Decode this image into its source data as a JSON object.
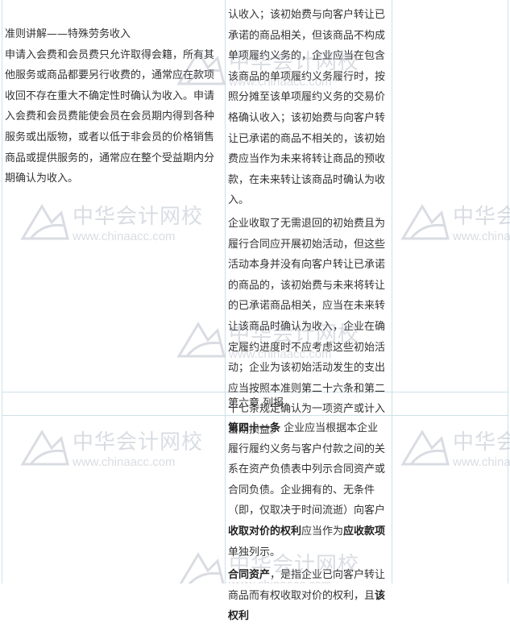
{
  "left_cell": {
    "title": "准则讲解——特殊劳务收入",
    "body": "申请入会费和会员费只允许取得会籍，所有其他服务或商品都要另行收费的，通常应在款项收回不存在重大不确定性时确认为收入。申请入会费和会员费能使会员在会员期内得到各种服务或出版物，或者以低于非会员的价格销售商品或提供服务的，通常应在整个受益期内分期确认为收入。"
  },
  "middle_top": {
    "para1": "认收入；该初始费与向客户转让已承诺的商品相关，但该商品不构成单项履约义务的，企业应当在包含该商品的单项履约义务履行时，按照分摊至该单项履约义务的交易价格确认收入；该初始费与向客户转让已承诺的商品不相关的，该初始费应当作为未来将转让商品的预收款，在未来转让该商品时确认为收入。",
    "para2": "企业收取了无需退回的初始费且为履行合同应开展初始活动，但这些活动本身并没有向客户转让已承诺的商品的，该初始费与未来将转让的已承诺商品相关，应当在未来转让该商品时确认为收入，企业在确定履约进度时不应考虑这些初始活动；企业为该初始活动发生的支出应当按照本准则第二十六条和第二十七条规定确认为一项资产或计入当期损益。"
  },
  "chapter": "第六章 列报",
  "article41": {
    "label": "第四十一条",
    "text1": "企业应当根据本企业履行履约义务与客户付款之间的关系在资产负债表中列示合同资产或合同负债。企业拥有的、无条件（即，仅取决于时间流逝）向客户",
    "bold1": "收取对价的权利",
    "text2": "应当作为",
    "bold2": "应收款项",
    "text3": "单独列示。"
  },
  "contract_assets": {
    "bold1": "合同资产",
    "text1": "，是指企业已向客户转让商品而有权收取对价的权利，且",
    "bold2": "该权利"
  },
  "watermark": {
    "cn": "中华会计网校",
    "en": "www.chinaacc.com"
  }
}
